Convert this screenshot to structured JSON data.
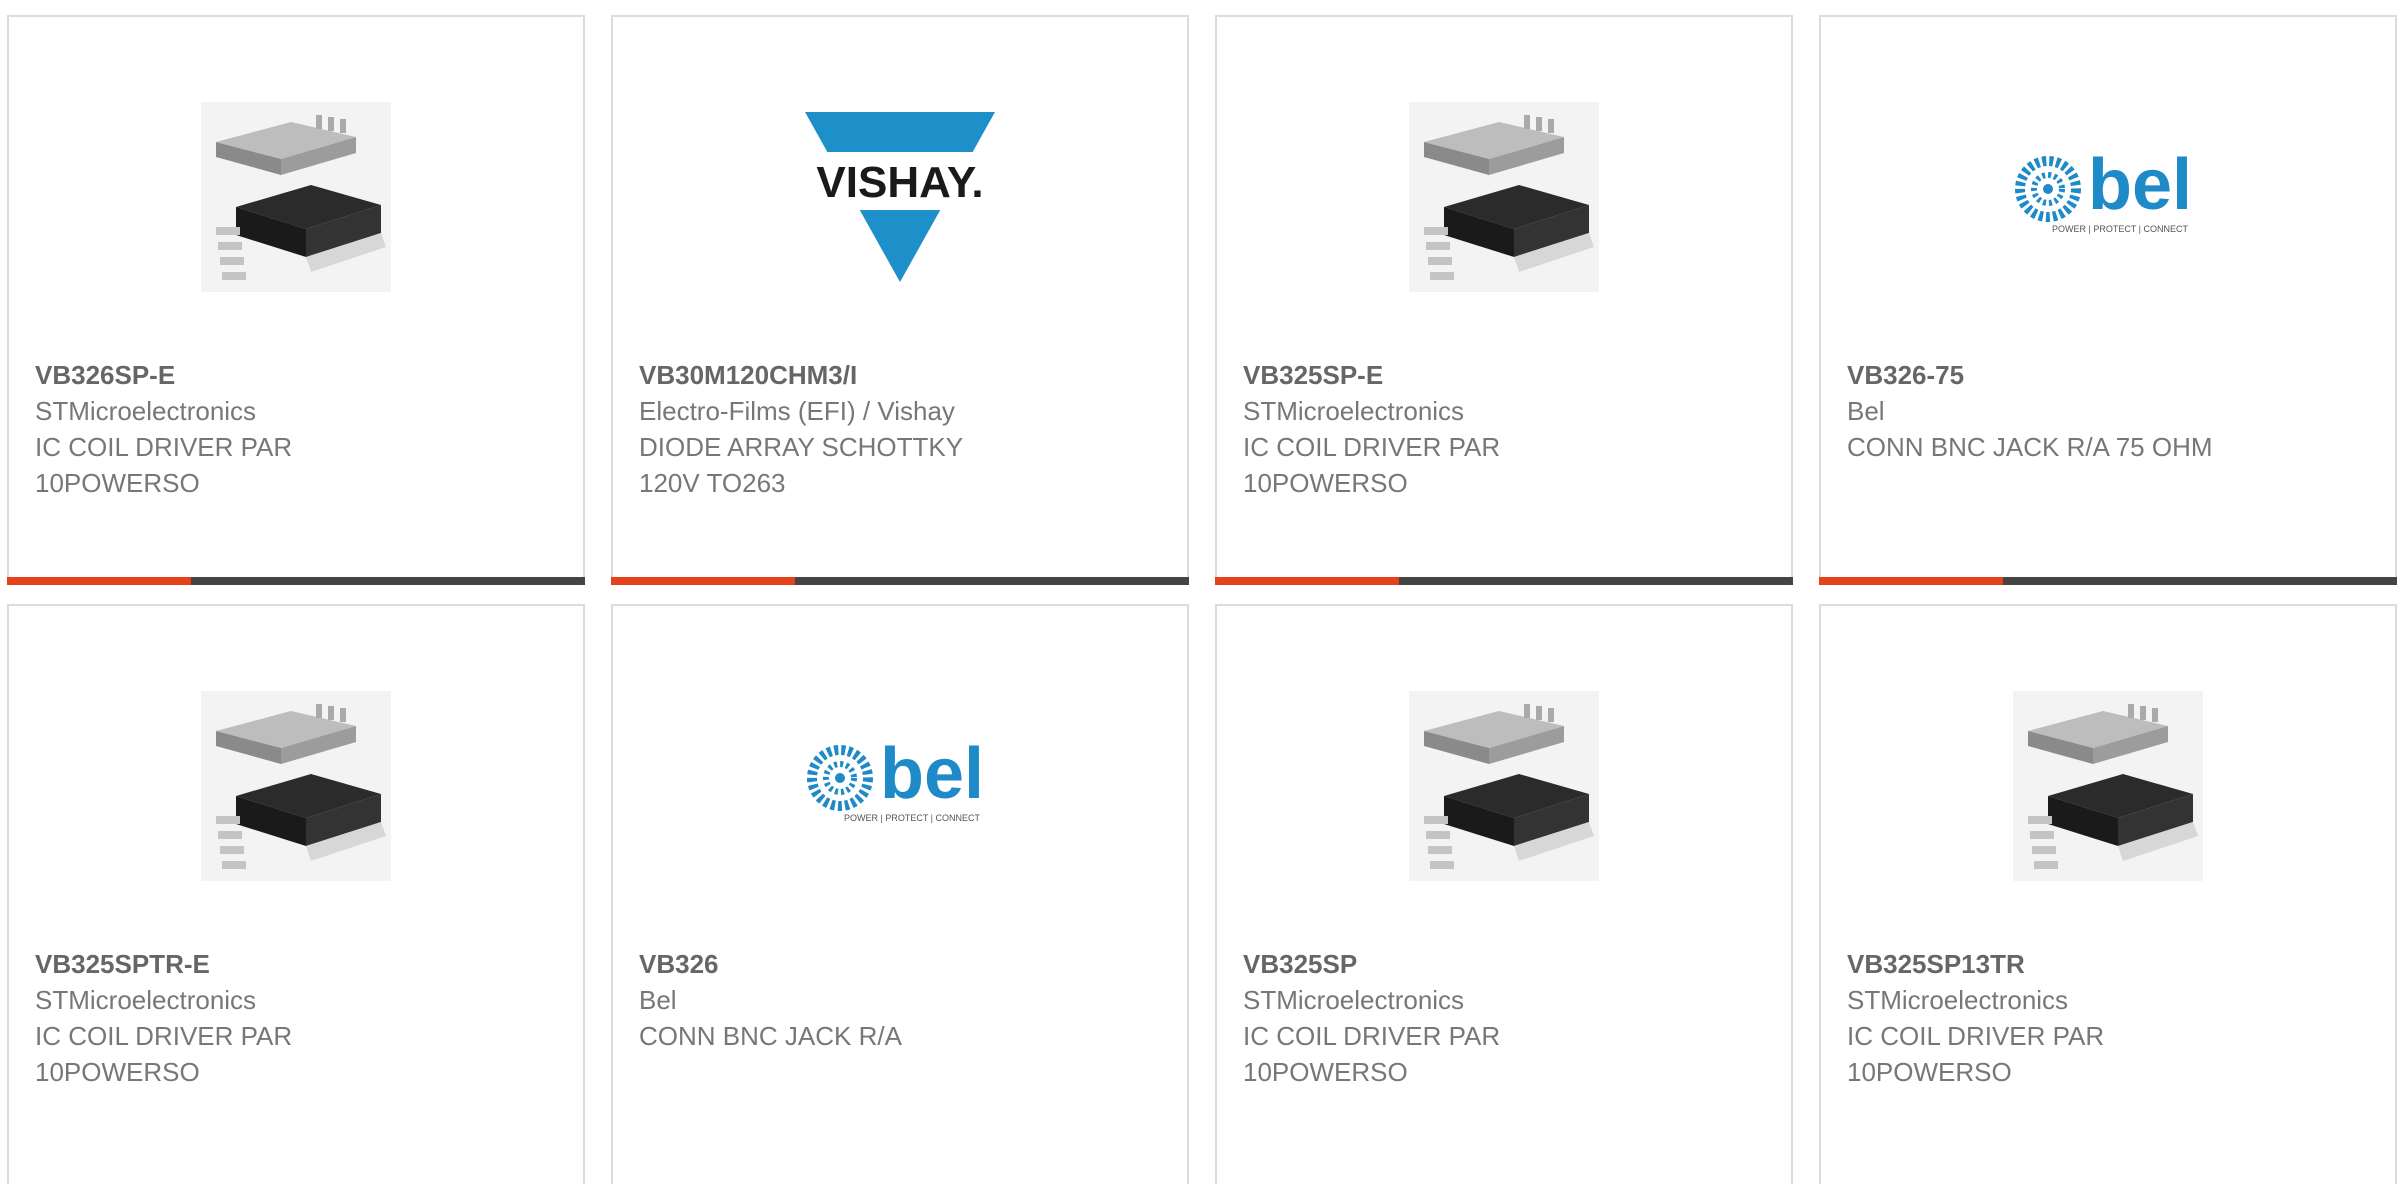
{
  "products": [
    {
      "part": "VB326SP-E",
      "mfr": "STMicroelectronics",
      "desc": "IC COIL DRIVER PAR\n10POWERSO",
      "image": "ic-package"
    },
    {
      "part": "VB30M120CHM3/I",
      "mfr": "Electro-Films (EFI) / Vishay",
      "desc": "DIODE ARRAY SCHOTTKY\n120V TO263",
      "image": "vishay-logo",
      "logo_text": "VISHAY."
    },
    {
      "part": "VB325SP-E",
      "mfr": "STMicroelectronics",
      "desc": "IC COIL DRIVER PAR\n10POWERSO",
      "image": "ic-package"
    },
    {
      "part": "VB326-75",
      "mfr": "Bel",
      "desc": "CONN BNC JACK R/A 75 OHM",
      "image": "bel-logo",
      "logo_text": "bel",
      "logo_tagline": "POWER | PROTECT | CONNECT"
    },
    {
      "part": "VB325SPTR-E",
      "mfr": "STMicroelectronics",
      "desc": "IC COIL DRIVER PAR\n10POWERSO",
      "image": "ic-package"
    },
    {
      "part": "VB326",
      "mfr": "Bel",
      "desc": "CONN BNC JACK R/A",
      "image": "bel-logo",
      "logo_text": "bel",
      "logo_tagline": "POWER | PROTECT | CONNECT"
    },
    {
      "part": "VB325SP",
      "mfr": "STMicroelectronics",
      "desc": "IC COIL DRIVER PAR\n10POWERSO",
      "image": "ic-package"
    },
    {
      "part": "VB325SP13TR",
      "mfr": "STMicroelectronics",
      "desc": "IC COIL DRIVER PAR\n10POWERSO",
      "image": "ic-package"
    }
  ],
  "colors": {
    "accent": "#e4421b",
    "accent_bar": "#444444",
    "text": "#777777",
    "vishay_blue": "#1d8fc9",
    "bel_blue": "#1f8ac8"
  }
}
